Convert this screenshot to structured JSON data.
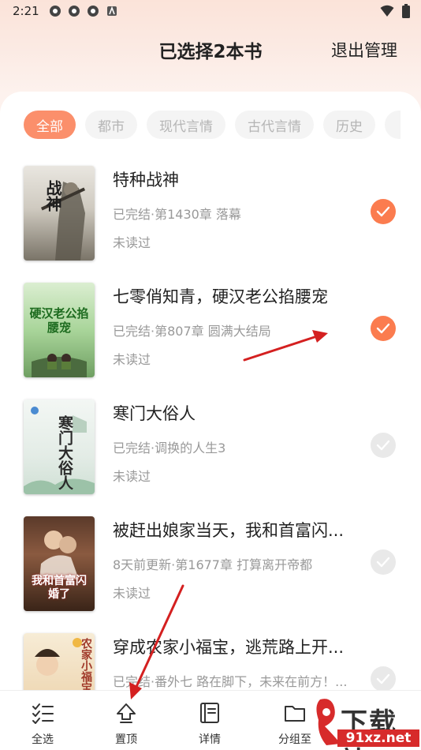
{
  "status_bar": {
    "time": "2:21"
  },
  "header": {
    "title": "已选择2本书",
    "exit_label": "退出管理"
  },
  "tabs": [
    {
      "label": "全部",
      "active": true
    },
    {
      "label": "都市",
      "active": false
    },
    {
      "label": "现代言情",
      "active": false
    },
    {
      "label": "古代言情",
      "active": false
    },
    {
      "label": "历史",
      "active": false
    }
  ],
  "books": [
    {
      "title": "特种战神",
      "status": "已完结·第1430章 落幕",
      "read": "未读过",
      "selected": true,
      "cover_text": "战神"
    },
    {
      "title": "七零俏知青，硬汉老公掐腰宠",
      "status": "已完结·第807章 圆满大结局",
      "read": "未读过",
      "selected": true,
      "cover_text": "硬汉老公掐腰宠"
    },
    {
      "title": "寒门大俗人",
      "status": "已完结·调换的人生3",
      "read": "未读过",
      "selected": false,
      "cover_text": "寒门大俗人"
    },
    {
      "title": "被赶出娘家当天，我和首富闪...",
      "status": "8天前更新·第1677章 打算离开帝都",
      "read": "未读过",
      "selected": false,
      "cover_text": "我和首富闪婚了"
    },
    {
      "title": "穿成农家小福宝，逃荒路上开...",
      "status": "已完结·番外七 路在脚下，未来在前方！...",
      "read": "",
      "selected": false,
      "cover_text": "农家小福宝"
    }
  ],
  "bottom_nav": [
    {
      "label": "全选",
      "icon": "select-all-icon"
    },
    {
      "label": "置顶",
      "icon": "pin-top-icon"
    },
    {
      "label": "详情",
      "icon": "details-icon"
    },
    {
      "label": "分组至",
      "icon": "folder-icon"
    }
  ],
  "watermark": {
    "top": "下载站",
    "bottom": "91xz.net"
  },
  "colors": {
    "accent": "#fb7c4f",
    "tab_active": "#fb8f6b",
    "arrow": "#d42020"
  }
}
